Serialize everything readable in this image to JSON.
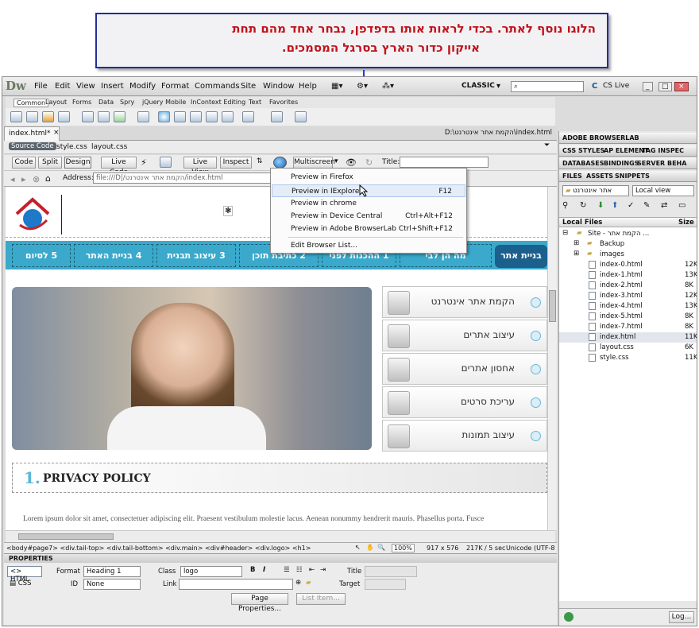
{
  "callout": {
    "line1": "הלוגו נוסף לאתר. בכדי לראות אותו בדפדפן, נבחר אחד מהם תחת",
    "line2": "אייקון כדור הארץ בסרגל המסמכים."
  },
  "app": {
    "logo": "Dw",
    "menus": [
      "File",
      "Edit",
      "View",
      "Insert",
      "Modify",
      "Format",
      "Commands",
      "Site",
      "Window",
      "Help"
    ],
    "workspace": "CLASSIC",
    "cslive": "CS Live"
  },
  "insert_tabs": [
    "Common",
    "Layout",
    "Forms",
    "Data",
    "Spry",
    "jQuery Mobile",
    "InContext Editing",
    "Text",
    "Favorites"
  ],
  "document": {
    "tab": "index.html*",
    "path": "D:\\הקמת אתר אינטרנט\\index.html",
    "source_code": "Source Code",
    "related": [
      "style.css",
      "layout.css"
    ]
  },
  "doc_toolbar": {
    "code": "Code",
    "split": "Split",
    "design": "Design",
    "live_code": "Live Code",
    "live_view": "Live View",
    "inspect": "Inspect",
    "multiscreen": "Multiscreen",
    "title_label": "Title:"
  },
  "address": {
    "label": "Address:",
    "value": "file:///D|/הקמת אתר אינטרנט/index.html"
  },
  "preview_menu": [
    {
      "label": "Preview in Firefox",
      "shortcut": ""
    },
    {
      "label": "Preview in IExplore",
      "shortcut": "F12"
    },
    {
      "label": "Preview in chrome",
      "shortcut": ""
    },
    {
      "label": "Preview in Device Central",
      "shortcut": "Ctrl+Alt+F12"
    },
    {
      "label": "Preview in Adobe BrowserLab",
      "shortcut": "Ctrl+Shift+F12"
    },
    {
      "label": "Edit Browser List...",
      "shortcut": ""
    }
  ],
  "site_nav": [
    "5 לסיום",
    "4 בניית האתר",
    "3 עיצוב תבנית",
    "2 כתיבת תוכן",
    "1 ההכנות לפני",
    "מה הן לבי",
    "בניית אתר"
  ],
  "services": [
    "הקמת אתר אינטרנט",
    "עיצוב אתרים",
    "אחסון אתרים",
    "עריכת סרטים",
    "עיצוב תמונות"
  ],
  "privacy": {
    "number": "1.",
    "title": "PRIVACY POLICY"
  },
  "lorem": "Lorem ipsum dolor sit amet, consectetuer adipiscing elit. Praesent vestibulum molestie lacus. Aenean nonummy hendrerit mauris. Phasellus porta. Fusce",
  "status": {
    "tags": "<body#page7> <div.tail-top> <div.tail-bottom> <div.main> <div#header> <div.logo> <h1>",
    "zoom": "100%",
    "size": "917 x 576",
    "info": "217K / 5 sec",
    "encoding": "Unicode (UTF-8"
  },
  "properties": {
    "title": "PROPERTIES",
    "html": "HTML",
    "css": "CSS",
    "format_label": "Format",
    "format": "Heading 1",
    "class_label": "Class",
    "class": "logo",
    "id_label": "ID",
    "id": "None",
    "link_label": "Link",
    "title_label": "Title",
    "target_label": "Target",
    "page_props": "Page Properties...",
    "list_item": "List Item..."
  },
  "panels": {
    "browserlab": "ADOBE BROWSERLAB",
    "css_tabs": [
      "CSS STYLES",
      "AP ELEMENT",
      "TAG INSPEC"
    ],
    "db_tabs": [
      "DATABASES",
      "BINDINGS",
      "SERVER BEHA"
    ],
    "file_tabs": [
      "FILES",
      "ASSETS",
      "SNIPPETS"
    ],
    "site_select": "אתר אינטרנט",
    "view_select": "Local view",
    "col_files": "Local Files",
    "col_size": "Size",
    "log": "Log..."
  },
  "files": [
    {
      "name": "Site - הקמת אתר ...",
      "size": "",
      "kind": "site"
    },
    {
      "name": "Backup",
      "size": "",
      "kind": "folder"
    },
    {
      "name": "images",
      "size": "",
      "kind": "folder"
    },
    {
      "name": "index-0.html",
      "size": "12K",
      "kind": "file"
    },
    {
      "name": "index-1.html",
      "size": "13K",
      "kind": "file"
    },
    {
      "name": "index-2.html",
      "size": "8K",
      "kind": "file"
    },
    {
      "name": "index-3.html",
      "size": "12K",
      "kind": "file"
    },
    {
      "name": "index-4.html",
      "size": "13K",
      "kind": "file"
    },
    {
      "name": "index-5.html",
      "size": "8K",
      "kind": "file"
    },
    {
      "name": "index-7.html",
      "size": "8K",
      "kind": "file"
    },
    {
      "name": "index.html",
      "size": "11K",
      "kind": "file"
    },
    {
      "name": "layout.css",
      "size": "6K",
      "kind": "file"
    },
    {
      "name": "style.css",
      "size": "11K",
      "kind": "file"
    }
  ]
}
